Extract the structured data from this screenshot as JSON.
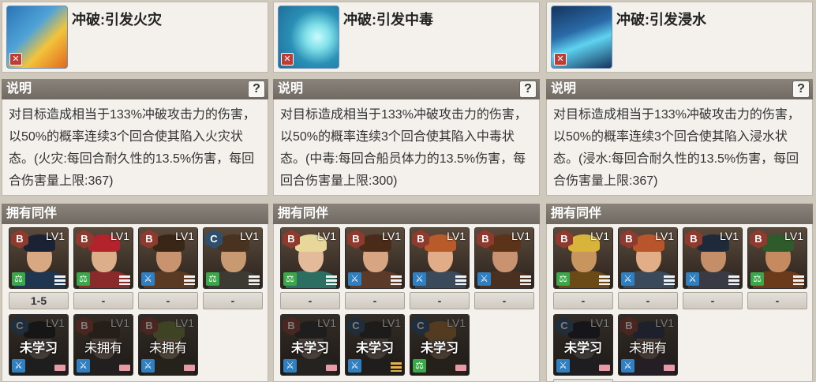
{
  "skills": [
    {
      "name": "冲破:引发火灾",
      "desc_title": "说明",
      "help": "?",
      "desc": "对目标造成相当于133%冲破攻击力的伤害，以50%的概率连续3个回合使其陷入火灾状态。(火灾:每回合耐久性的13.5%伤害，每回合伤害量上限:367)",
      "companions_title": "拥有同伴",
      "colors": [
        "#2b74b6",
        "#f3c33b"
      ]
    },
    {
      "name": "冲破:引发中毒",
      "desc_title": "说明",
      "help": "?",
      "desc": "对目标造成相当于133%冲破攻击力的伤害，以50%的概率连续3个回合使其陷入中毒状态。(中毒:每回合船员体力的13.5%伤害，每回合伤害量上限:300)",
      "companions_title": "拥有同伴",
      "colors": [
        "#1f6f99",
        "#7fe0e8"
      ]
    },
    {
      "name": "冲破:引发浸水",
      "desc_title": "说明",
      "help": "?",
      "desc": "对目标造成相当于133%冲破攻击力的伤害，以50%的概率连续3个回合使其陷入浸水状态。(浸水:每回合耐久性的13.5%伤害，每回合伤害量上限:367)",
      "companions_title": "拥有同伴",
      "colors": [
        "#15345e",
        "#5fd2f0"
      ]
    }
  ],
  "companions": {
    "col1": {
      "row1": [
        {
          "rank": "B",
          "lv": "LV1",
          "type": "trade",
          "slot": "1-5",
          "skin": "#d8a883",
          "hair": "#1a2233",
          "cloth": "#1f3550"
        },
        {
          "rank": "B",
          "lv": "LV1",
          "type": "trade",
          "slot": "-",
          "skin": "#dcae8a",
          "hair": "#b3232b",
          "cloth": "#8a2a2a"
        },
        {
          "rank": "B",
          "lv": "LV1",
          "type": "adv",
          "slot": "-",
          "skin": "#c99370",
          "hair": "#3a2616",
          "cloth": "#5a3a22"
        },
        {
          "rank": "C",
          "lv": "LV1",
          "type": "trade",
          "slot": "-",
          "skin": "#c89a72",
          "hair": "#4a3220",
          "cloth": "#3c3a32"
        }
      ],
      "row2": [
        {
          "rank": "C",
          "lv": "LV1",
          "type": "adv",
          "status": "未学习",
          "skin": "#7a6a60",
          "hair": "#1a1a1a",
          "cloth": "#2a2a2a"
        },
        {
          "rank": "B",
          "lv": "LV1",
          "type": "adv",
          "status": "未拥有",
          "skin": "#8a7262",
          "hair": "#3a2a20",
          "cloth": "#33302a"
        },
        {
          "rank": "B",
          "lv": "LV1",
          "type": "adv",
          "status": "未拥有",
          "skin": "#8f785e",
          "hair": "#6f7d36",
          "cloth": "#3a3424"
        }
      ]
    },
    "col2": {
      "row1": [
        {
          "rank": "B",
          "lv": "LV1",
          "type": "trade",
          "slot": "-",
          "skin": "#e3bb9b",
          "hair": "#e8d79a",
          "cloth": "#2c6e62"
        },
        {
          "rank": "B",
          "lv": "LV1",
          "type": "adv",
          "slot": "-",
          "skin": "#d7a582",
          "hair": "#4a2a18",
          "cloth": "#5b3a2a"
        },
        {
          "rank": "B",
          "lv": "LV1",
          "type": "adv",
          "slot": "-",
          "skin": "#e0ad88",
          "hair": "#b85a2a",
          "cloth": "#3a4a5a"
        },
        {
          "rank": "B",
          "lv": "LV1",
          "type": "adv",
          "slot": "-",
          "skin": "#c99270",
          "hair": "#5a3318",
          "cloth": "#4a3020"
        }
      ],
      "row2": [
        {
          "rank": "B",
          "lv": "LV1",
          "type": "adv",
          "status": "未学习",
          "skin": "#8c7464",
          "hair": "#2a2a2a",
          "cloth": "#3a3530"
        },
        {
          "rank": "C",
          "lv": "LV1",
          "type": "adv",
          "status": "未学习",
          "bars": "gold",
          "skin": "#7c6a5c",
          "hair": "#2a2622",
          "cloth": "#2e2c28"
        },
        {
          "rank": "C",
          "lv": "LV1",
          "type": "trade",
          "status": "未学习",
          "skin": "#8a6c50",
          "hair": "#a06a30",
          "cloth": "#3a3020"
        }
      ]
    },
    "col3": {
      "row1": [
        {
          "rank": "B",
          "lv": "LV1",
          "type": "trade",
          "slot": "-",
          "skin": "#c8955f",
          "hair": "#d8b43a",
          "cloth": "#6b4a18"
        },
        {
          "rank": "B",
          "lv": "LV1",
          "type": "adv",
          "slot": "-",
          "skin": "#e2ae88",
          "hair": "#b8552a",
          "cloth": "#3a4a5a"
        },
        {
          "rank": "B",
          "lv": "LV1",
          "type": "adv",
          "slot": "-",
          "skin": "#c48e68",
          "hair": "#1e2a3a",
          "cloth": "#3a3a44"
        },
        {
          "rank": "B",
          "lv": "LV1",
          "type": "trade",
          "slot": "-",
          "skin": "#c58a60",
          "hair": "#2f5a2a",
          "cloth": "#6a3a1a"
        }
      ],
      "row2": [
        {
          "rank": "C",
          "lv": "LV1",
          "type": "adv",
          "status": "未学习",
          "skin": "#6e6460",
          "hair": "#1a1a22",
          "cloth": "#2a2a30"
        },
        {
          "rank": "B",
          "lv": "LV1",
          "type": "adv",
          "status": "未拥有",
          "skin": "#7e6658",
          "hair": "#2a2f4a",
          "cloth": "#3a2a3a"
        }
      ]
    }
  },
  "col3_row2_slot_partial": "-"
}
